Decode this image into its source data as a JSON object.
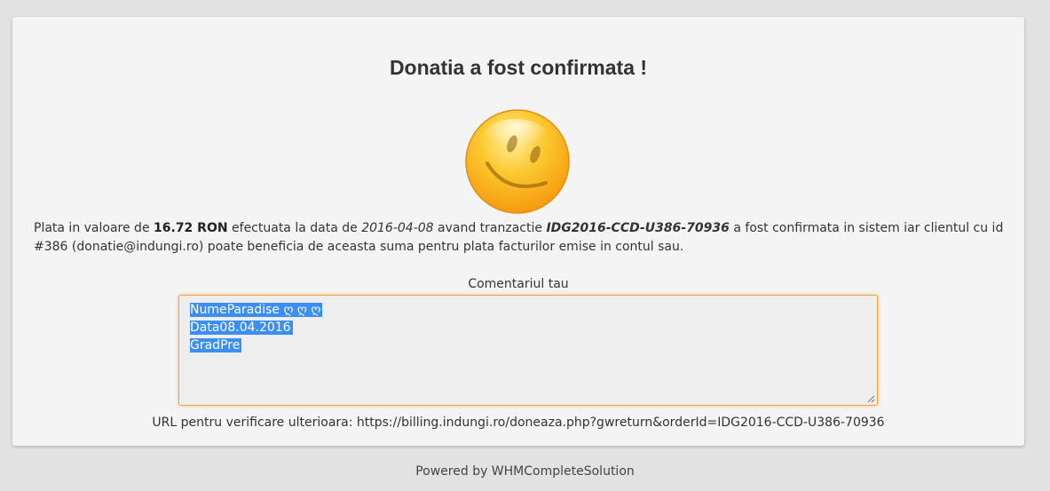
{
  "title": "Donatia a fost confirmata !",
  "smiley_icon": "smiley-face-icon",
  "payment": {
    "t1": "Plata in valoare de ",
    "amount": "16.72 RON",
    "t2": " efectuata la data de ",
    "date": "2016-04-08",
    "t3": " avand tranzactie ",
    "transaction": "IDG2016-CCD-U386-70936",
    "t4": " a fost confirmata in sistem iar clientul cu id #386 (donatie@indungi.ro) poate beneficia de aceasta suma pentru plata facturilor emise in contul sau."
  },
  "comment": {
    "label": "Comentariul tau",
    "lines": [
      "NumeParadise ღ ღ ღ ",
      "Data08.04.2016  ",
      "GradPre"
    ]
  },
  "url_line": "URL pentru verificare ulterioara: https://billing.indungi.ro/doneaza.php?gwreturn&orderId=IDG2016-CCD-U386-70936",
  "footer": "Powered by WHMCompleteSolution",
  "colors": {
    "background": "#e2e2e2",
    "card": "#f4f4f4",
    "textarea_border": "#f0a43a",
    "selection": "#3b8ff3"
  }
}
